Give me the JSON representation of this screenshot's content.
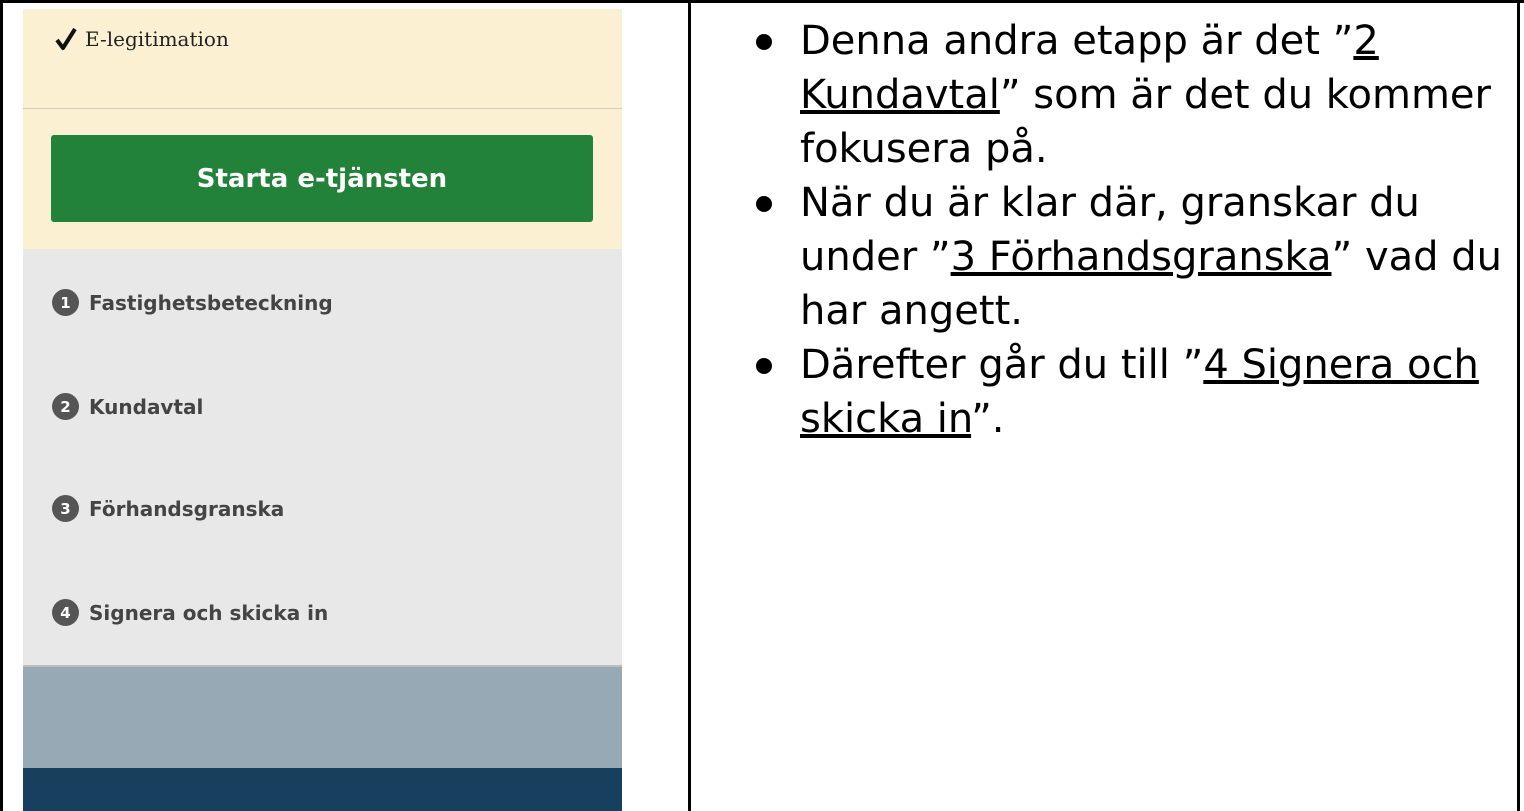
{
  "sidebar": {
    "completed_step": "E-legitimation",
    "start_button": "Starta e-tjänsten",
    "steps": [
      {
        "number": "1",
        "label": "Fastighetsbeteckning"
      },
      {
        "number": "2",
        "label": "Kundavtal"
      },
      {
        "number": "3",
        "label": "Förhandsgranska"
      },
      {
        "number": "4",
        "label": "Signera och skicka in"
      }
    ]
  },
  "notes": {
    "b1_pre": "Denna andra etapp är det ”",
    "b1_link": "2 Kundavtal",
    "b1_post": "” som är det du kommer fokusera på.",
    "b2_pre": "När du är klar där, granskar du under ”",
    "b2_link": "3 Förhandsgranska",
    "b2_post": "” vad du har angett.",
    "b3_pre": "Därefter går du till ”",
    "b3_link": "4 Signera och skicka in",
    "b3_post": "”."
  },
  "colors": {
    "top_panel": "#fcf0d2",
    "start_button": "#22823a",
    "steps_panel": "#e8e8e8",
    "step_badge": "#555555",
    "grey_band": "#97a9b4",
    "navy_band": "#17405e"
  }
}
